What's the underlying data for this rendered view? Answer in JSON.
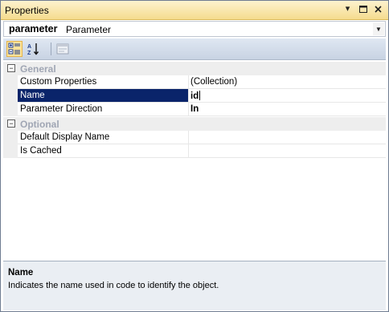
{
  "window": {
    "title": "Properties",
    "controls": {
      "pin_glyph": "▾",
      "maximize_glyph": "▭",
      "close_glyph": "✕"
    }
  },
  "object_selector": {
    "name": "parameter",
    "type": "Parameter"
  },
  "toolbar": {
    "buttons": [
      {
        "name": "categorized-icon",
        "active": true
      },
      {
        "name": "alphabetical-icon",
        "active": false
      },
      {
        "name": "property-pages-icon",
        "active": false
      }
    ]
  },
  "grid": {
    "categories": [
      {
        "label": "General",
        "expander": "⊟",
        "properties": [
          {
            "name": "Custom Properties",
            "value": "(Collection)",
            "bold": false
          },
          {
            "name": "Name",
            "value": "id",
            "bold": true,
            "selected": true
          },
          {
            "name": "Parameter Direction",
            "value": "In",
            "bold": true
          }
        ]
      },
      {
        "label": "Optional",
        "expander": "⊟",
        "properties": [
          {
            "name": "Default Display Name",
            "value": ""
          },
          {
            "name": "Is Cached",
            "value": ""
          }
        ]
      }
    ]
  },
  "description": {
    "title": "Name",
    "text": "Indicates the name used in code to identify the object."
  },
  "colors": {
    "title_bar": "#f5dc8e",
    "selection": "#0a246a",
    "category_text": "#a0a6b4"
  }
}
